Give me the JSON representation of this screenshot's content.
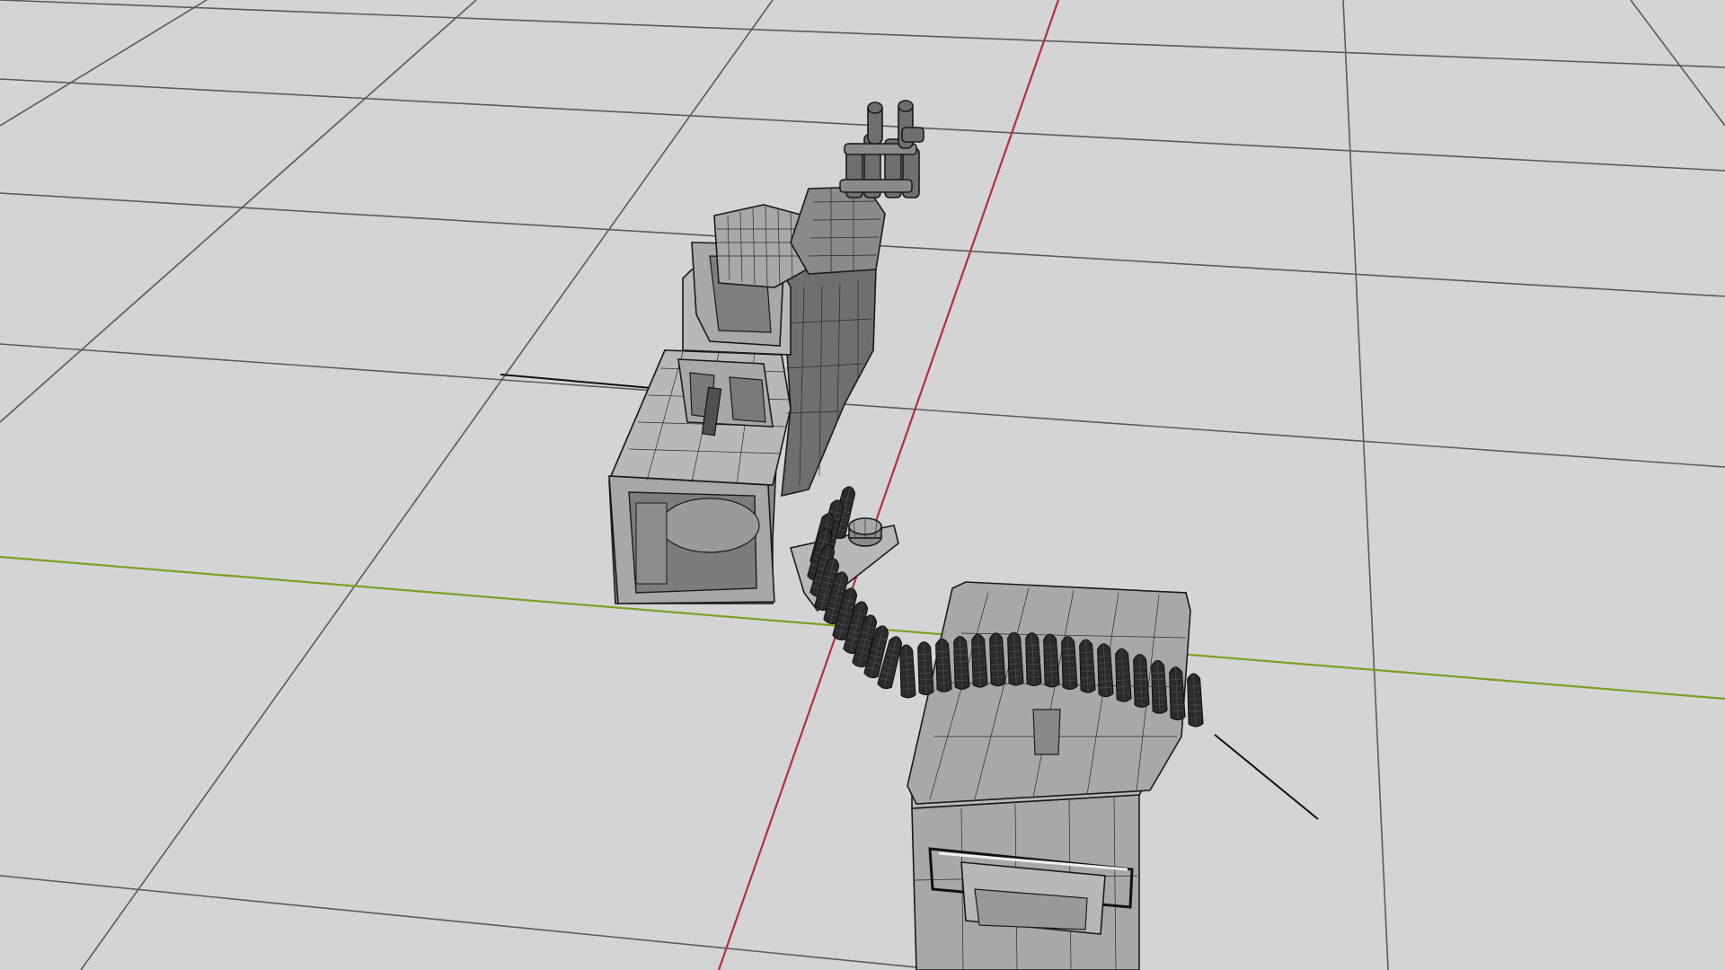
{
  "viewport": {
    "background": "#d4d4d4",
    "grid_color": "#5b5b5b",
    "x_axis_color": "#7aa024",
    "y_axis_color": "#b03040",
    "model_wire_color": "#1a1a1a",
    "model_fill_color": "#8a8a8a",
    "shading": "wireframe-on-shaded"
  },
  "scene_objects": [
    {
      "name": "minigun",
      "icon": "minigun-model"
    },
    {
      "name": "ammo-belt",
      "icon": "ammo-belt-model"
    },
    {
      "name": "ammo-box",
      "icon": "ammo-box-model"
    },
    {
      "name": "mount-plate",
      "icon": "mount-plate-model"
    }
  ]
}
